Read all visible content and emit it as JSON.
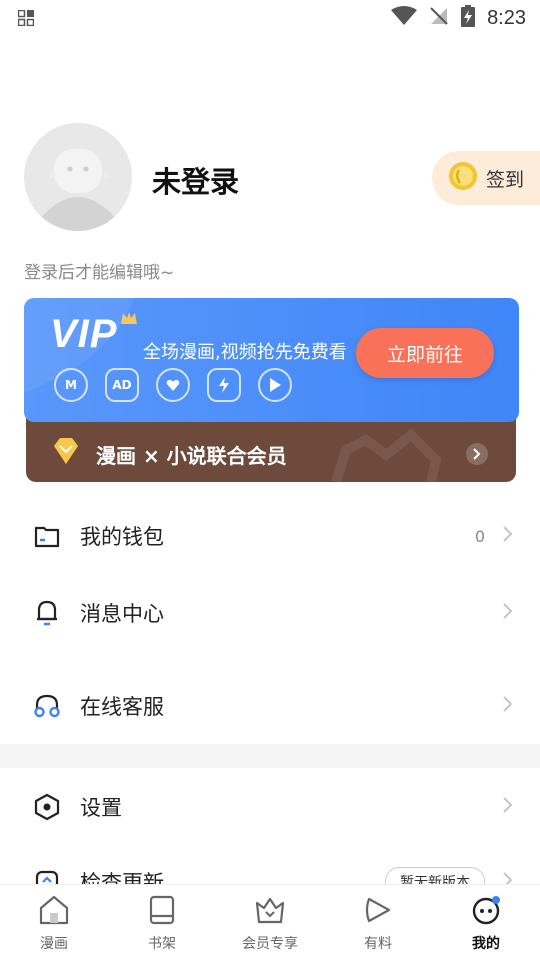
{
  "status_bar": {
    "time": "8:23"
  },
  "profile": {
    "username": "未登录",
    "checkin_label": "签到",
    "hint": "登录后才能编辑哦~"
  },
  "vip": {
    "logo": "VIP",
    "description": "全场漫画,视频抢先免费看",
    "button_label": "立即前往",
    "union_label": "漫画 × 小说联合会员",
    "benefit_icons": [
      "comic-m-icon",
      "ad-free-icon",
      "heart-icon",
      "lightning-shield-icon",
      "play-icon"
    ]
  },
  "menu": {
    "wallet": {
      "label": "我的钱包",
      "value": "0"
    },
    "messages": {
      "label": "消息中心"
    },
    "support": {
      "label": "在线客服"
    },
    "settings": {
      "label": "设置"
    },
    "update": {
      "label": "检查更新",
      "badge": "暂无新版本"
    }
  },
  "tabs": [
    {
      "label": "漫画",
      "icon": "home-icon"
    },
    {
      "label": "书架",
      "icon": "bookshelf-icon"
    },
    {
      "label": "会员专享",
      "icon": "vip-crown-icon"
    },
    {
      "label": "有料",
      "icon": "play-bubble-icon"
    },
    {
      "label": "我的",
      "icon": "profile-face-icon",
      "active": true
    }
  ],
  "colors": {
    "vip_blue": "#3f86f8",
    "vip_button": "#f97158",
    "union_brown": "#6e4a3c",
    "checkin_bg": "#fdecd9",
    "accent_blue": "#3b82f6"
  }
}
